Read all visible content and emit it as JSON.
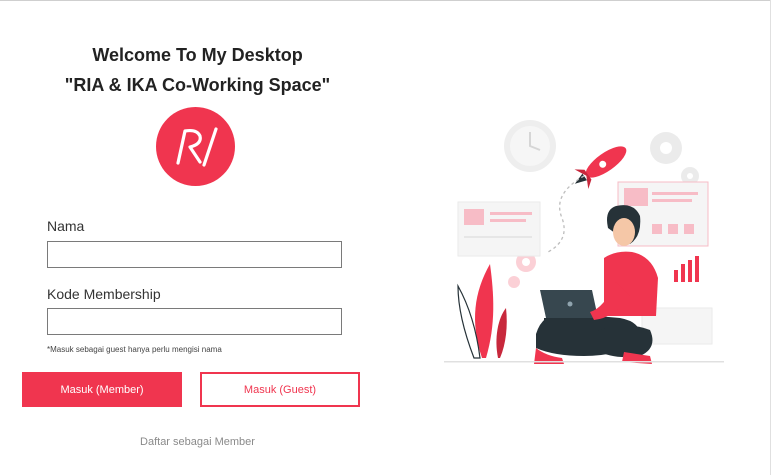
{
  "welcome": {
    "line1": "Welcome To My Desktop",
    "line2": "\"RIA & IKA Co-Working Space\""
  },
  "logo": {
    "text": "RI",
    "color": "#f0354f"
  },
  "form": {
    "nama_label": "Nama",
    "nama_value": "",
    "membership_label": "Kode Membership",
    "membership_value": "",
    "note": "*Masuk sebagai guest hanya perlu mengisi nama"
  },
  "buttons": {
    "member": "Masuk (Member)",
    "guest": "Masuk (Guest)"
  },
  "register_link": "Daftar sebagai Member",
  "colors": {
    "accent": "#f0354f",
    "illustration_dark": "#263238"
  },
  "illustration": {
    "name": "woman-with-laptop-and-rocket-illustration"
  }
}
